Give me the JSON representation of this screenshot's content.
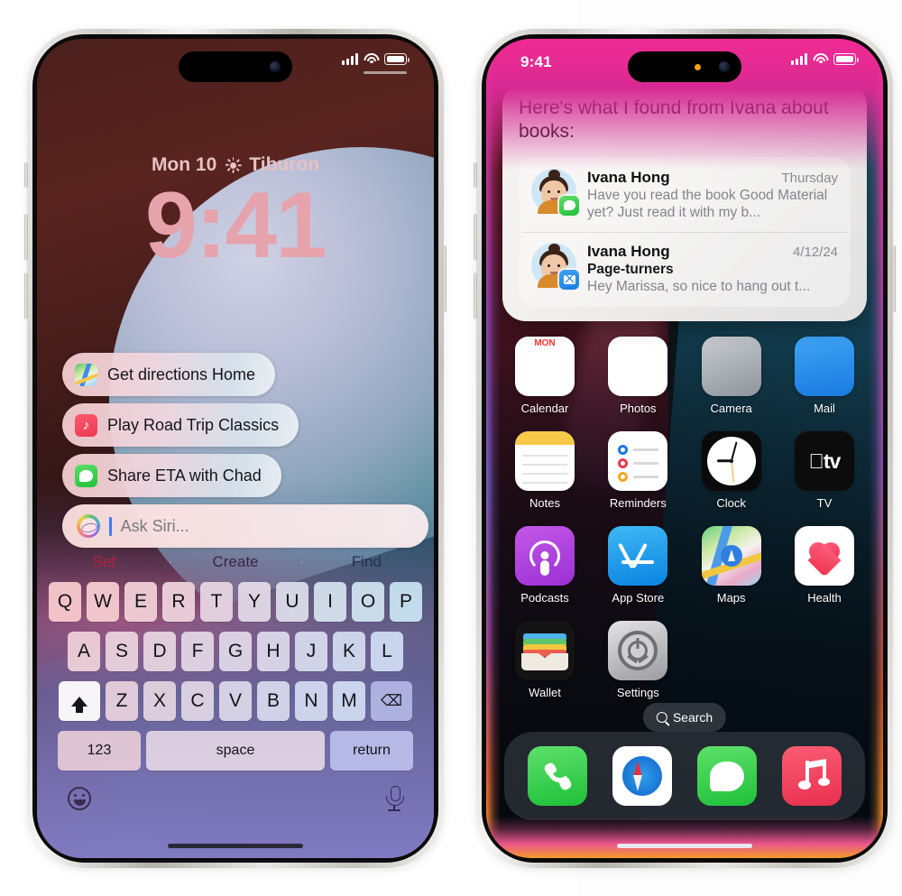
{
  "page": {
    "background_color": "#ffffff"
  },
  "lock_phone": {
    "name": "iphone-lock-screen",
    "status_bar": {
      "icons": [
        "signal-icon",
        "wifi-icon",
        "battery-icon"
      ]
    },
    "date_line": "Mon 10",
    "weather_icon": "sun-icon",
    "location": "Tiburon",
    "time": "9:41",
    "siri_chips": [
      {
        "icon": "maps-icon",
        "label": "Get directions Home"
      },
      {
        "icon": "music-icon",
        "label": "Play Road Trip Classics"
      },
      {
        "icon": "messages-icon",
        "label": "Share ETA with Chad"
      }
    ],
    "ask_siri": {
      "icon": "siri-orb-icon",
      "placeholder": "Ask Siri..."
    },
    "keyboard": {
      "predictions": [
        "Set",
        "Create",
        "Find"
      ],
      "row1": [
        "Q",
        "W",
        "E",
        "R",
        "T",
        "Y",
        "U",
        "I",
        "O",
        "P"
      ],
      "row2": [
        "A",
        "S",
        "D",
        "F",
        "G",
        "H",
        "J",
        "K",
        "L"
      ],
      "row3": [
        "Z",
        "X",
        "C",
        "V",
        "B",
        "N",
        "M"
      ],
      "shift_label": "shift-icon",
      "backspace_label": "backspace-icon",
      "numbers_key": "123",
      "space_key": "space",
      "return_key": "return",
      "emoji_key": "emoji-icon",
      "dictation_key": "microphone-icon"
    }
  },
  "home_phone": {
    "name": "iphone-home-screen",
    "status_bar": {
      "time": "9:41",
      "icons": [
        "signal-icon",
        "wifi-icon",
        "battery-icon"
      ],
      "mic_indicator": "orange"
    },
    "siri_card": {
      "heading": "Here's what I found from Ivana about books:",
      "results": [
        {
          "avatar": "memoji-avatar",
          "badge": "messages-icon",
          "name": "Ivana Hong",
          "date": "Thursday",
          "subject": "",
          "preview": "Have you read the book Good Material yet? Just read it with my b..."
        },
        {
          "avatar": "memoji-avatar",
          "badge": "mail-icon",
          "name": "Ivana Hong",
          "date": "4/12/24",
          "subject": "Page-turners",
          "preview": "Hey Marissa, so nice to hang out t..."
        }
      ]
    },
    "app_rows": [
      [
        {
          "icon": "calendar-icon",
          "label": "Calendar"
        },
        {
          "icon": "photos-icon",
          "label": "Photos"
        },
        {
          "icon": "camera-icon",
          "label": "Camera"
        },
        {
          "icon": "mail-icon",
          "label": "Mail"
        }
      ],
      [
        {
          "icon": "notes-icon",
          "label": "Notes"
        },
        {
          "icon": "reminders-icon",
          "label": "Reminders"
        },
        {
          "icon": "clock-icon",
          "label": "Clock"
        },
        {
          "icon": "tv-icon",
          "label": "TV"
        }
      ],
      [
        {
          "icon": "podcasts-icon",
          "label": "Podcasts"
        },
        {
          "icon": "app-store-icon",
          "label": "App Store"
        },
        {
          "icon": "maps-icon",
          "label": "Maps"
        },
        {
          "icon": "health-icon",
          "label": "Health"
        }
      ],
      [
        {
          "icon": "wallet-icon",
          "label": "Wallet"
        },
        {
          "icon": "settings-icon",
          "label": "Settings"
        }
      ]
    ],
    "search_pill": {
      "icon": "search-icon",
      "label": "Search"
    },
    "dock": [
      {
        "icon": "phone-icon",
        "label": "Phone"
      },
      {
        "icon": "safari-icon",
        "label": "Safari"
      },
      {
        "icon": "messages-icon",
        "label": "Messages"
      },
      {
        "icon": "music-icon",
        "label": "Music"
      }
    ],
    "siri_glow_colors": {
      "top": "#ef2a93",
      "bottom": "#f59b2a"
    }
  }
}
